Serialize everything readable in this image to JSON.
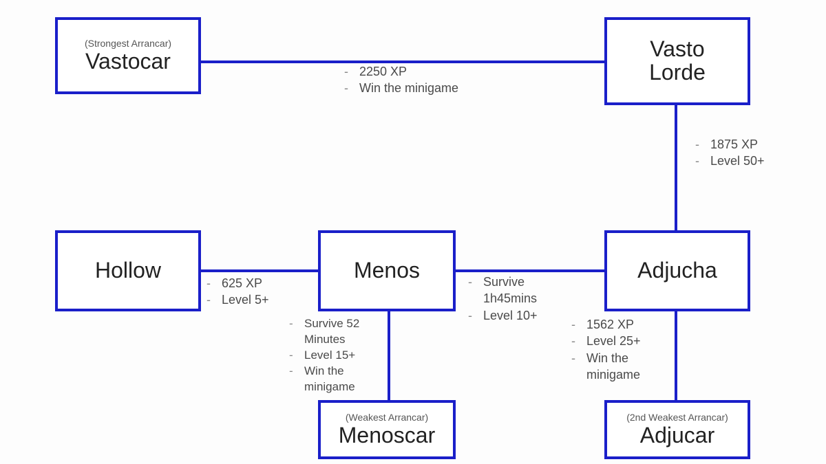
{
  "nodes": {
    "vastocar": {
      "subtitle": "(Strongest Arrancar)",
      "title": "Vastocar"
    },
    "vastolorde": {
      "subtitle": "",
      "title": "Vasto\nLorde"
    },
    "hollow": {
      "subtitle": "",
      "title": "Hollow"
    },
    "menos": {
      "subtitle": "",
      "title": "Menos"
    },
    "adjucha": {
      "subtitle": "",
      "title": "Adjucha"
    },
    "menoscar": {
      "subtitle": "(Weakest Arrancar)",
      "title": "Menoscar"
    },
    "adjucar": {
      "subtitle": "(2nd Weakest Arrancar)",
      "title": "Adjucar"
    }
  },
  "reqs": {
    "vastocar_vastolorde": [
      "2250 XP",
      "Win the minigame"
    ],
    "vastolorde_adjucha": [
      "1875 XP",
      "Level 50+"
    ],
    "hollow_menos": [
      "625 XP",
      "Level 5+"
    ],
    "menos_adjucha": [
      "Survive",
      "1h45mins",
      "Level 10+"
    ],
    "menos_menoscar": [
      "Survive 52",
      "Minutes",
      "Level 15+",
      "Win the",
      "minigame"
    ],
    "adjucha_adjucar": [
      "1562 XP",
      "Level 25+",
      "Win the",
      "minigame"
    ]
  }
}
